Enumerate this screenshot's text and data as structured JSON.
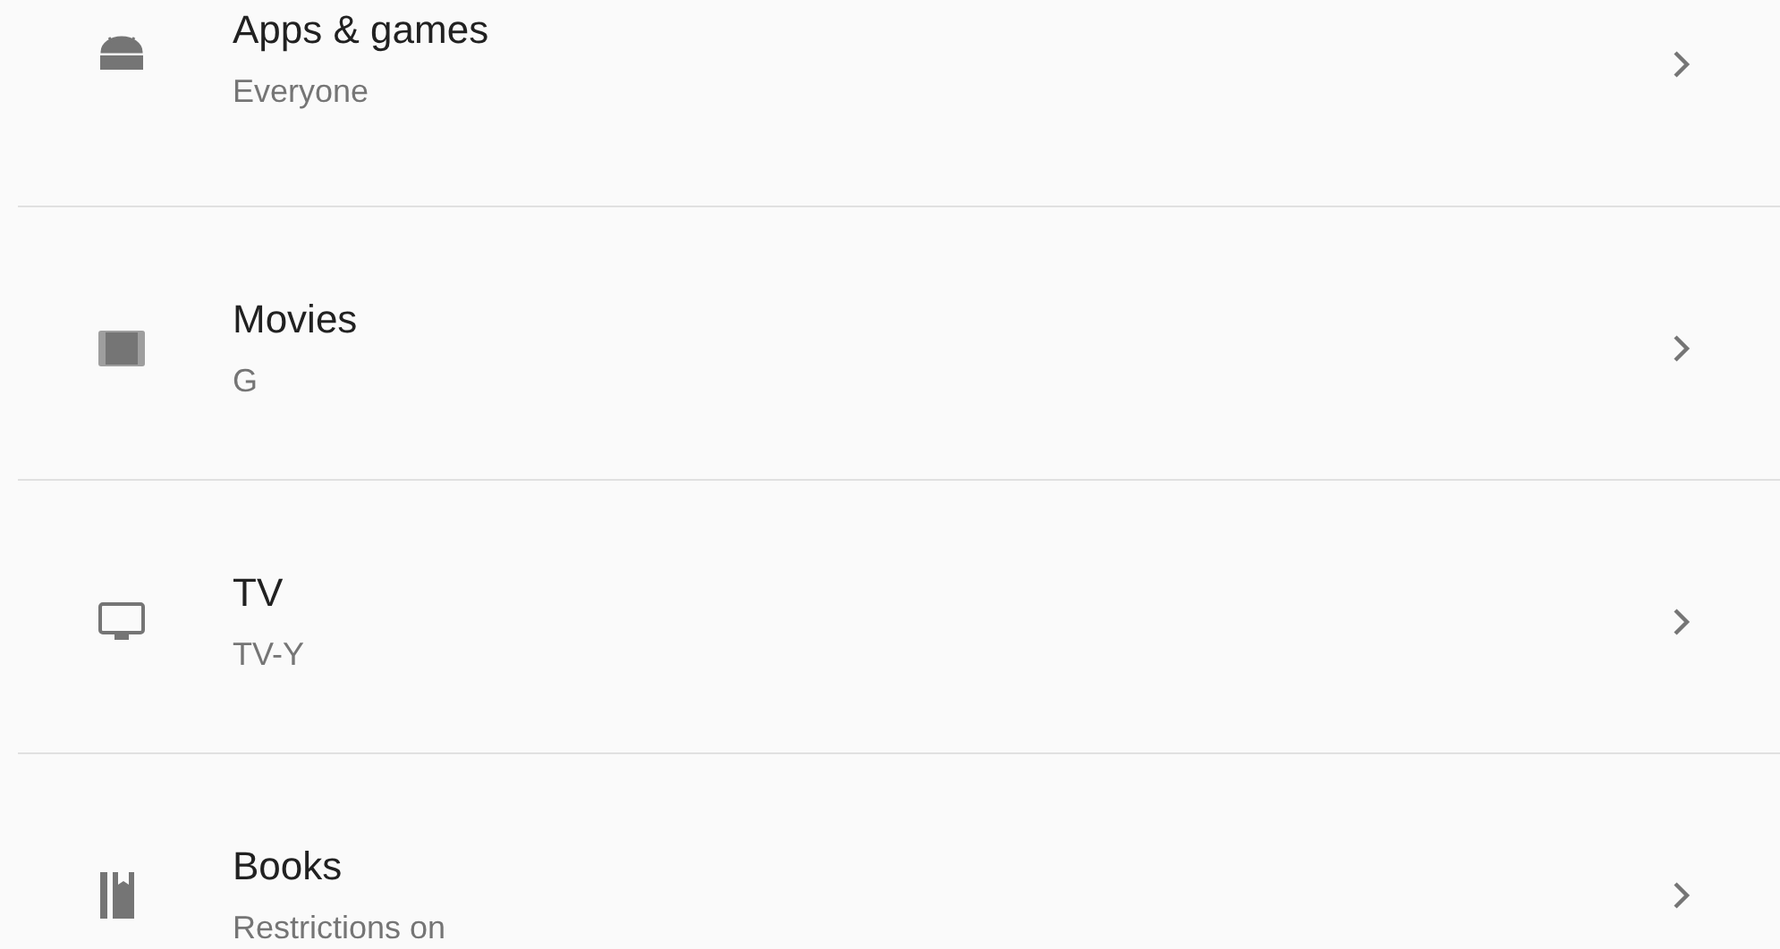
{
  "items": [
    {
      "kind": "apps",
      "title": "Apps & games",
      "subtitle": "Everyone"
    },
    {
      "kind": "movies",
      "title": "Movies",
      "subtitle": "G"
    },
    {
      "kind": "tv",
      "title": "TV",
      "subtitle": "TV-Y"
    },
    {
      "kind": "books",
      "title": "Books",
      "subtitle": "Restrictions on"
    }
  ]
}
